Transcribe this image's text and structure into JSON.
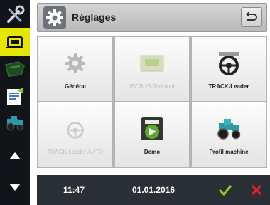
{
  "header": {
    "title": "Réglages",
    "icon": "gear-icon",
    "back_icon": "back-arrow-icon"
  },
  "sidebar": {
    "items": [
      {
        "icon": "tools-icon"
      },
      {
        "icon": "terminal-icon",
        "active": true
      },
      {
        "icon": "map-icon"
      },
      {
        "icon": "document-icon"
      },
      {
        "icon": "tractor-icon"
      },
      {
        "icon": "arrow-up-icon"
      },
      {
        "icon": "arrow-down-icon"
      }
    ]
  },
  "tiles": [
    {
      "label": "Général",
      "icon": "gear-icon",
      "enabled": true
    },
    {
      "label": "ISOBUS-Terminal",
      "icon": "terminal-screen-icon",
      "enabled": false
    },
    {
      "label": "TRACK-Leader",
      "icon": "steering-wheel-icon",
      "enabled": true
    },
    {
      "label": "TRACK-Leader AUTO",
      "icon": "steering-auto-icon",
      "enabled": false
    },
    {
      "label": "Demo",
      "icon": "demo-icon",
      "enabled": true
    },
    {
      "label": "Profil machine",
      "icon": "tractor-icon",
      "enabled": true
    }
  ],
  "footer": {
    "time": "11:47",
    "date": "01.01.2016"
  },
  "colors": {
    "active_sidebar": "#e6e600",
    "ok": "#8cd11b",
    "cancel": "#e2232a",
    "tractor": "#2e9aa6"
  }
}
